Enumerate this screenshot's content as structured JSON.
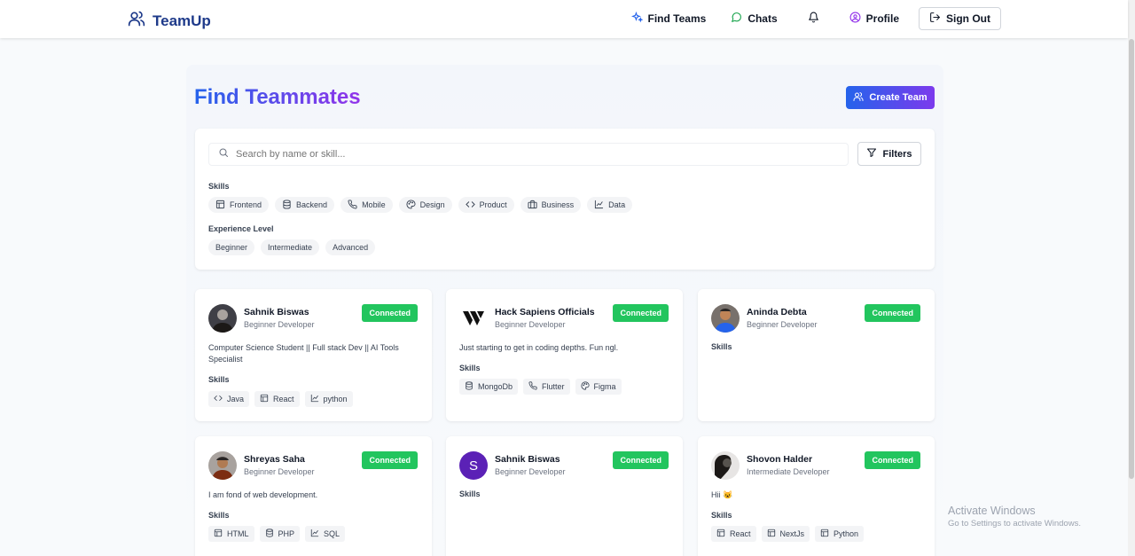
{
  "brand": {
    "name": "TeamUp"
  },
  "nav": {
    "find_teams": "Find Teams",
    "chats": "Chats",
    "profile": "Profile",
    "sign_out": "Sign Out"
  },
  "page": {
    "title": "Find Teammates",
    "create_team": "Create Team"
  },
  "search": {
    "placeholder": "Search by name or skill...",
    "filters": "Filters"
  },
  "filters": {
    "skills_label": "Skills",
    "skills": [
      {
        "label": "Frontend",
        "icon": "layout-icon"
      },
      {
        "label": "Backend",
        "icon": "database-icon"
      },
      {
        "label": "Mobile",
        "icon": "phone-icon"
      },
      {
        "label": "Design",
        "icon": "palette-icon"
      },
      {
        "label": "Product",
        "icon": "code-icon"
      },
      {
        "label": "Business",
        "icon": "briefcase-icon"
      },
      {
        "label": "Data",
        "icon": "chart-icon"
      }
    ],
    "experience_label": "Experience Level",
    "experience": [
      "Beginner",
      "Intermediate",
      "Advanced"
    ]
  },
  "users": [
    {
      "name": "Sahnik Biswas",
      "level": "Beginner Developer",
      "status": "Connected",
      "bio": "Computer Science Student || Full stack Dev || AI Tools Specialist",
      "skills_label": "Skills",
      "skills": [
        {
          "label": "Java",
          "icon": "code-icon"
        },
        {
          "label": "React",
          "icon": "layout-icon"
        },
        {
          "label": "python",
          "icon": "chart-icon"
        }
      ]
    },
    {
      "name": "Hack Sapiens Officials",
      "level": "Beginner Developer",
      "status": "Connected",
      "bio": "Just starting to get in coding depths. Fun ngl.",
      "skills_label": "Skills",
      "skills": [
        {
          "label": "MongoDb",
          "icon": "database-icon"
        },
        {
          "label": "Flutter",
          "icon": "phone-icon"
        },
        {
          "label": "Figma",
          "icon": "palette-icon"
        }
      ]
    },
    {
      "name": "Aninda Debta",
      "level": "Beginner Developer",
      "status": "Connected",
      "bio": "",
      "skills_label": "Skills",
      "skills": []
    },
    {
      "name": "Shreyas Saha",
      "level": "Beginner Developer",
      "status": "Connected",
      "bio": "I am fond of web development.",
      "skills_label": "Skills",
      "skills": [
        {
          "label": "HTML",
          "icon": "layout-icon"
        },
        {
          "label": "PHP",
          "icon": "database-icon"
        },
        {
          "label": "SQL",
          "icon": "chart-icon"
        }
      ]
    },
    {
      "name": "Sahnik Biswas",
      "level": "Beginner Developer",
      "status": "Connected",
      "bio": "",
      "avatar_letter": "S",
      "skills_label": "Skills",
      "skills": []
    },
    {
      "name": "Shovon Halder",
      "level": "Intermediate Developer",
      "status": "Connected",
      "bio": "Hii 😺",
      "skills_label": "Skills",
      "skills": [
        {
          "label": "React",
          "icon": "layout-icon"
        },
        {
          "label": "NextJs",
          "icon": "layout-icon"
        },
        {
          "label": "Python",
          "icon": "layout-icon"
        }
      ]
    }
  ],
  "watermark": {
    "line1": "Activate Windows",
    "line2": "Go to Settings to activate Windows."
  },
  "colors": {
    "brand": "#1e3a8a",
    "accent_start": "#2563eb",
    "accent_end": "#9333ea",
    "connected": "#22c55e"
  }
}
